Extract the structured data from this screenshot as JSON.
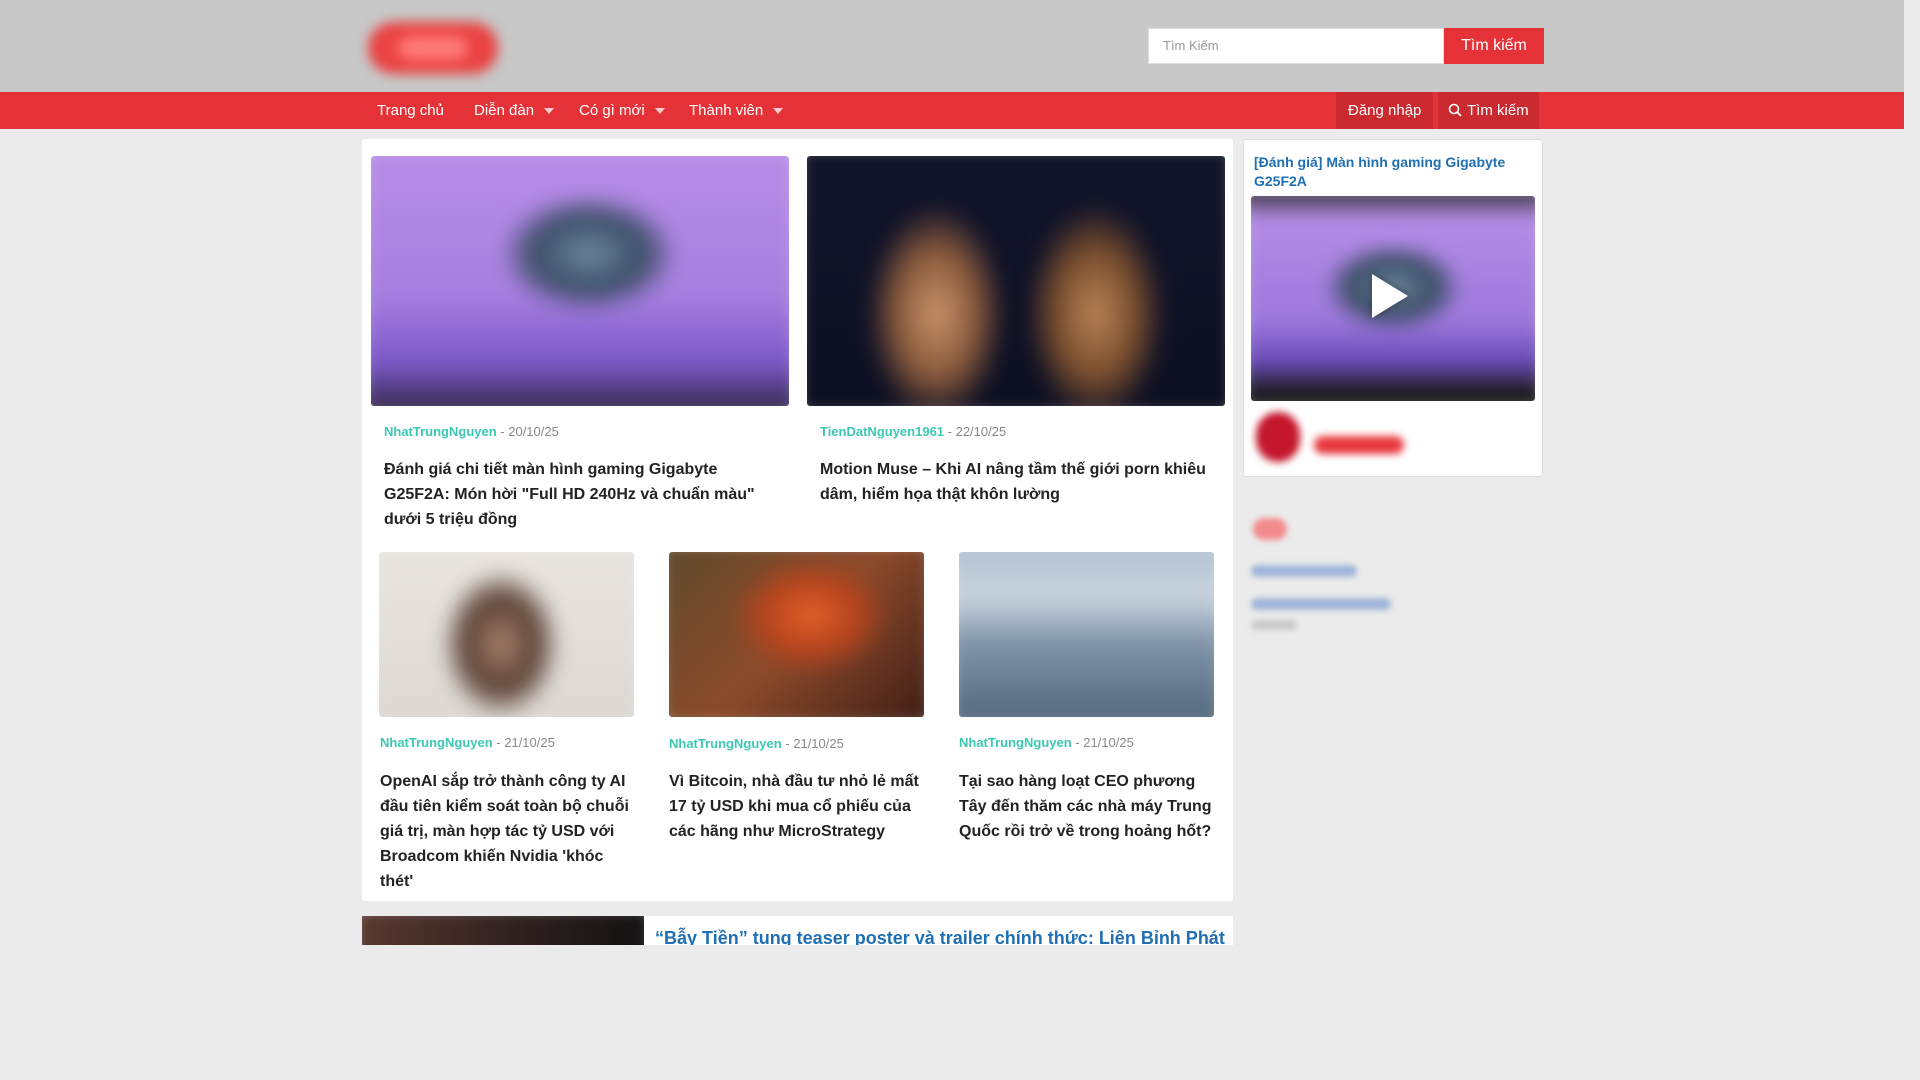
{
  "header": {
    "search_placeholder": "Tìm Kiếm",
    "search_button": "Tìm kiếm"
  },
  "nav": {
    "items": [
      {
        "label": "Trang chủ",
        "has_dropdown": false
      },
      {
        "label": "Diễn đàn",
        "has_dropdown": true
      },
      {
        "label": "Có gì mới",
        "has_dropdown": true
      },
      {
        "label": "Thành viên",
        "has_dropdown": true
      }
    ],
    "login": "Đăng nhập",
    "search": "Tìm kiếm"
  },
  "featured": [
    {
      "author": "NhatTrungNguyen",
      "date": "- 20/10/25",
      "title": "Đánh giá chi tiết màn hình gaming Gigabyte G25F2A: Món hời \"Full HD 240Hz và chuẩn màu\" dưới 5 triệu đồng"
    },
    {
      "author": "TienDatNguyen1961",
      "date": "- 22/10/25",
      "title": "Motion Muse – Khi AI nâng tầm thế giới porn khiêu dâm, hiểm họa thật khôn lường"
    }
  ],
  "articles": [
    {
      "author": "NhatTrungNguyen",
      "date": "- 21/10/25",
      "title": "OpenAI sắp trở thành công ty AI đầu tiên kiểm soát toàn bộ chuỗi giá trị, màn hợp tác tỷ USD với Broadcom khiến Nvidia 'khóc thét'"
    },
    {
      "author": "NhatTrungNguyen",
      "date": "- 21/10/25",
      "title": "Vì Bitcoin, nhà đầu tư nhỏ lẻ mất 17 tỷ USD khi mua cổ phiếu của các hãng như MicroStrategy"
    },
    {
      "author": "NhatTrungNguyen",
      "date": "- 21/10/25",
      "title": "Tại sao hàng loạt CEO phương Tây đến thăm các nhà máy Trung Quốc rồi trở về trong hoảng hốt?"
    }
  ],
  "list": {
    "first_title": "“Bẫy Tiền” tung teaser poster và trailer chính thức: Liên Bỉnh Phát"
  },
  "sidebar": {
    "video_title": "[Đánh giá] Màn hình gaming Gigabyte G25F2A"
  },
  "colors": {
    "brand_red": "#e53238",
    "author_teal": "#3cc8b4",
    "link_blue": "#1f6fb2"
  }
}
